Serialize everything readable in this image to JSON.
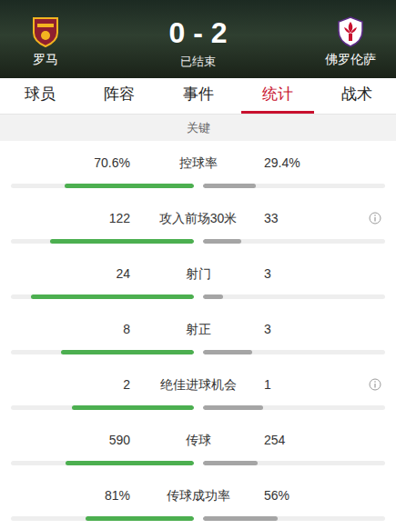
{
  "header": {
    "home": {
      "name": "罗马"
    },
    "away": {
      "name": "佛罗伦萨"
    },
    "score": "0 - 2",
    "status": "已结束"
  },
  "tabs": [
    {
      "label": "球员",
      "selected": false
    },
    {
      "label": "阵容",
      "selected": false
    },
    {
      "label": "事件",
      "selected": false
    },
    {
      "label": "统计",
      "selected": true
    },
    {
      "label": "战术",
      "selected": false
    }
  ],
  "section": "关键",
  "stats": [
    {
      "label": "控球率",
      "home": "70.6%",
      "away": "29.4%",
      "home_level": 0.706,
      "away_level": 0.294,
      "info": false
    },
    {
      "label": "攻入前场30米",
      "home": "122",
      "away": "33",
      "home_level": 0.787,
      "away_level": 0.213,
      "info": true
    },
    {
      "label": "射门",
      "home": "24",
      "away": "3",
      "home_level": 0.889,
      "away_level": 0.111,
      "info": false
    },
    {
      "label": "射正",
      "home": "8",
      "away": "3",
      "home_level": 0.727,
      "away_level": 0.273,
      "info": false
    },
    {
      "label": "绝佳进球机会",
      "home": "2",
      "away": "1",
      "home_level": 0.667,
      "away_level": 0.333,
      "info": true
    },
    {
      "label": "传球",
      "home": "590",
      "away": "254",
      "home_level": 0.699,
      "away_level": 0.301,
      "info": false
    },
    {
      "label": "传球成功率",
      "home": "81%",
      "away": "56%",
      "home_level": 0.591,
      "away_level": 0.409,
      "info": false
    }
  ]
}
